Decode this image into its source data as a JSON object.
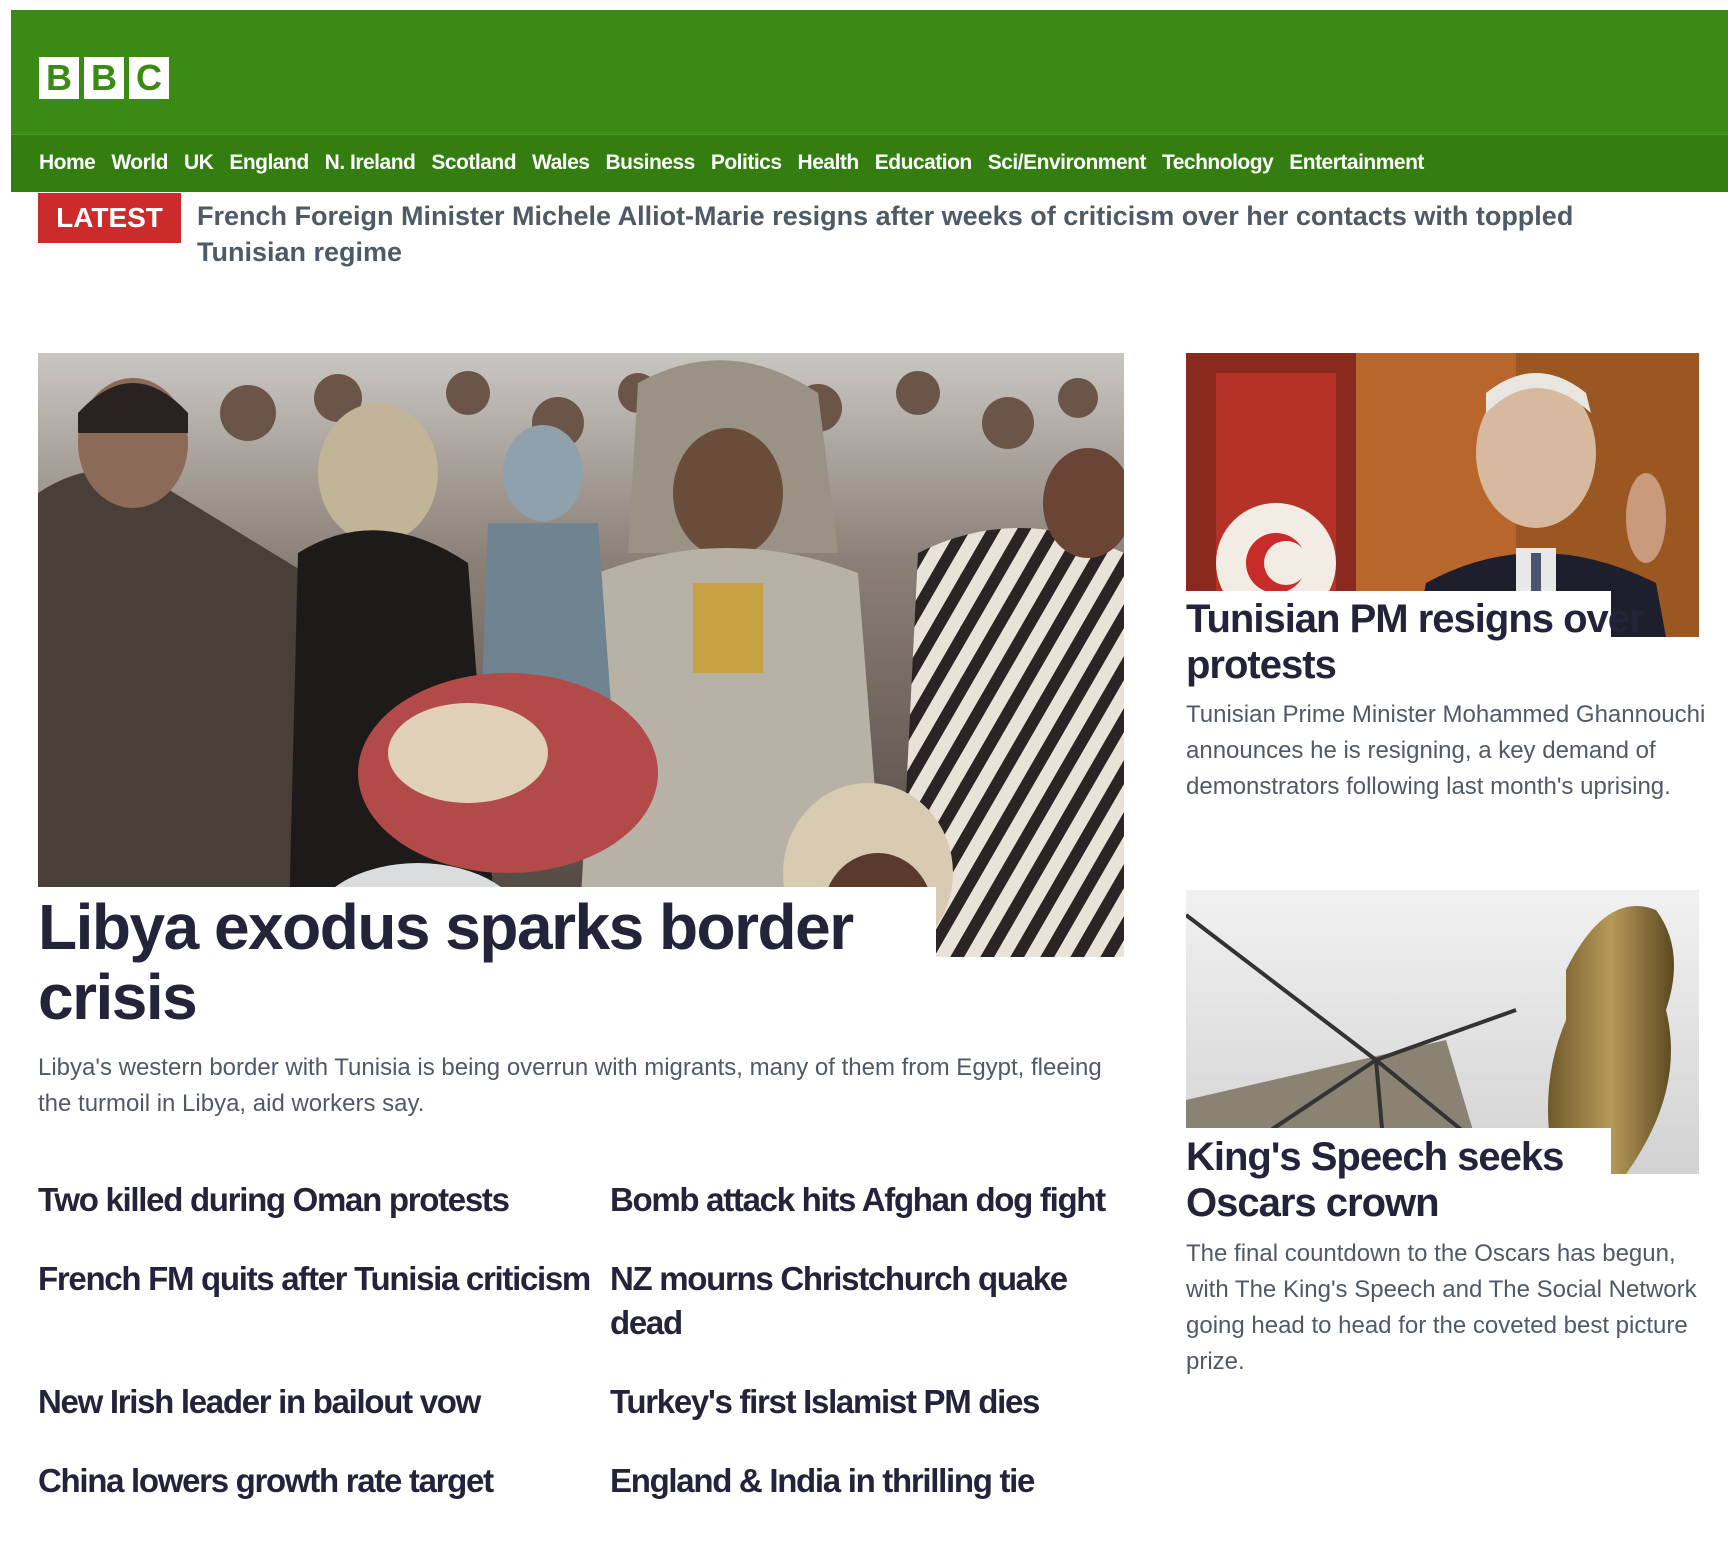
{
  "header": {
    "logo_letters": [
      "B",
      "B",
      "C"
    ],
    "nav": [
      "Home",
      "World",
      "UK",
      "England",
      "N. Ireland",
      "Scotland",
      "Wales",
      "Business",
      "Politics",
      "Health",
      "Education",
      "Sci/Environment",
      "Technology",
      "Entertainment"
    ]
  },
  "latest": {
    "badge": "LATEST",
    "text": "French Foreign Minister Michele Alliot-Marie resigns after weeks of criticism over her contacts with toppled Tunisian regime"
  },
  "main_story": {
    "title": "Libya exodus sparks border crisis",
    "summary": "Libya's western border with Tunisia is being overrun with migrants, many of them from Egypt, fleeing the turmoil in Libya, aid workers say."
  },
  "headlines": [
    "Two killed during Oman protests",
    "Bomb attack hits Afghan dog fight",
    "French FM quits after Tunisia criticism",
    "NZ mourns Christchurch quake dead",
    "New Irish leader in bailout vow",
    "Turkey's first Islamist PM dies",
    "China lowers growth rate target",
    "England & India in thrilling tie"
  ],
  "side_stories": [
    {
      "title": "Tunisian PM resigns over protests",
      "summary": "Tunisian Prime Minister Mohammed Ghannouchi announces he is resigning, a key demand of demonstrators following last month's uprising."
    },
    {
      "title": "King's Speech seeks Oscars crown",
      "summary": "The final countdown to the Oscars has begun, with The King's Speech and The Social Network going head to head for the coveted best picture prize."
    }
  ],
  "colors": {
    "brand_green": "#3a8a13",
    "latest_red": "#cc2b2b",
    "headline_text": "#23233a"
  }
}
